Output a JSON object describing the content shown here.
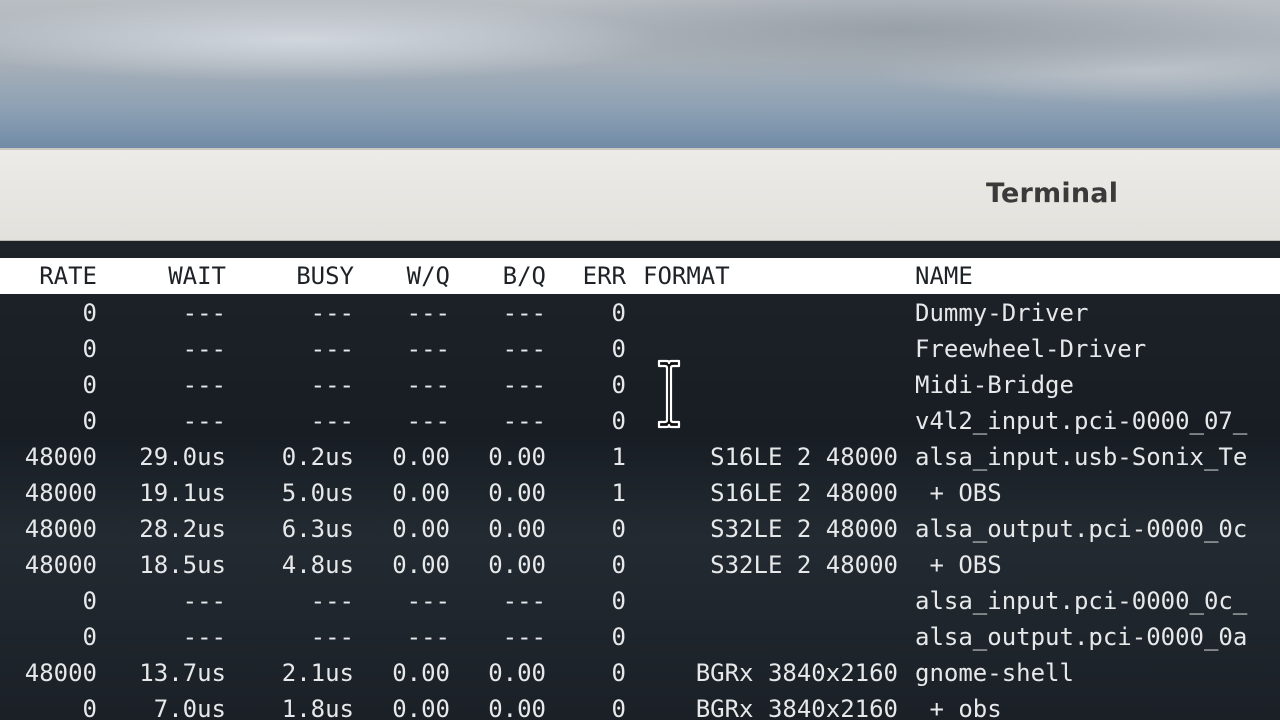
{
  "window": {
    "title": "Terminal"
  },
  "columns": {
    "rate": "RATE",
    "wait": "WAIT",
    "busy": "BUSY",
    "wq": "W/Q",
    "bq": "B/Q",
    "err": "ERR",
    "format": "FORMAT",
    "name": "NAME"
  },
  "rows": [
    {
      "rate": "0",
      "wait": "---",
      "busy": "---",
      "wq": "---",
      "bq": "---",
      "err": "0",
      "format": "",
      "name": "Dummy-Driver"
    },
    {
      "rate": "0",
      "wait": "---",
      "busy": "---",
      "wq": "---",
      "bq": "---",
      "err": "0",
      "format": "",
      "name": "Freewheel-Driver"
    },
    {
      "rate": "0",
      "wait": "---",
      "busy": "---",
      "wq": "---",
      "bq": "---",
      "err": "0",
      "format": "",
      "name": "Midi-Bridge"
    },
    {
      "rate": "0",
      "wait": "---",
      "busy": "---",
      "wq": "---",
      "bq": "---",
      "err": "0",
      "format": "",
      "name": "v4l2_input.pci-0000_07_"
    },
    {
      "rate": "48000",
      "wait": "29.0us",
      "busy": "0.2us",
      "wq": "0.00",
      "bq": "0.00",
      "err": "1",
      "format": "S16LE 2 48000",
      "name": "alsa_input.usb-Sonix_Te"
    },
    {
      "rate": "48000",
      "wait": "19.1us",
      "busy": "5.0us",
      "wq": "0.00",
      "bq": "0.00",
      "err": "1",
      "format": "S16LE 2 48000",
      "name": " + OBS"
    },
    {
      "rate": "48000",
      "wait": "28.2us",
      "busy": "6.3us",
      "wq": "0.00",
      "bq": "0.00",
      "err": "0",
      "format": "S32LE 2 48000",
      "name": "alsa_output.pci-0000_0c"
    },
    {
      "rate": "48000",
      "wait": "18.5us",
      "busy": "4.8us",
      "wq": "0.00",
      "bq": "0.00",
      "err": "0",
      "format": "S32LE 2 48000",
      "name": " + OBS"
    },
    {
      "rate": "0",
      "wait": "---",
      "busy": "---",
      "wq": "---",
      "bq": "---",
      "err": "0",
      "format": "",
      "name": "alsa_input.pci-0000_0c_"
    },
    {
      "rate": "0",
      "wait": "---",
      "busy": "---",
      "wq": "---",
      "bq": "---",
      "err": "0",
      "format": "",
      "name": "alsa_output.pci-0000_0a"
    },
    {
      "rate": "48000",
      "wait": "13.7us",
      "busy": "2.1us",
      "wq": "0.00",
      "bq": "0.00",
      "err": "0",
      "format": "BGRx 3840x2160",
      "name": "gnome-shell"
    },
    {
      "rate": "0",
      "wait": "7.0us",
      "busy": "1.8us",
      "wq": "0.00",
      "bq": "0.00",
      "err": "0",
      "format": "BGRx 3840x2160",
      "name": " + obs"
    }
  ]
}
